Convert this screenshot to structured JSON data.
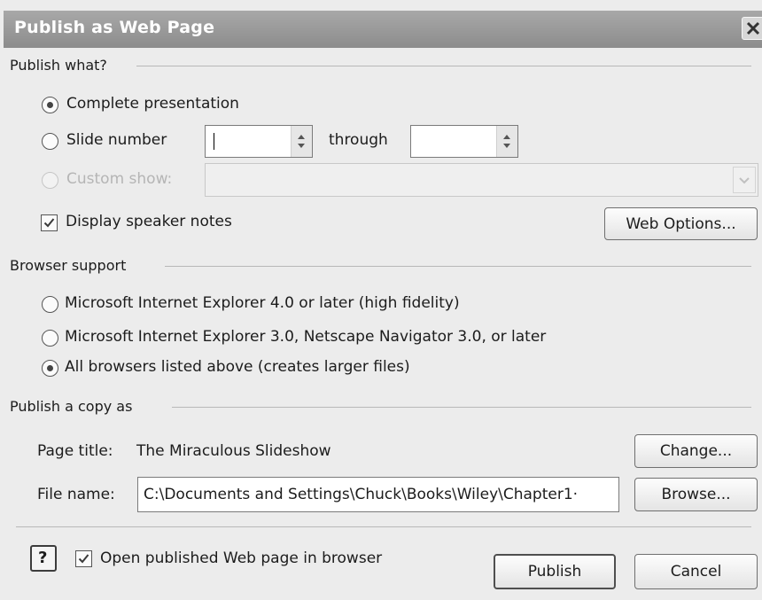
{
  "dialog": {
    "title": "Publish as Web Page",
    "close_icon": "close-icon"
  },
  "publish_what": {
    "legend": "Publish what?",
    "complete_label": "Complete presentation",
    "slide_number_label": "Slide number",
    "slide_from_value": "",
    "through_label": "through",
    "slide_to_value": "",
    "custom_show_label": "Custom show:",
    "custom_show_value": "",
    "speaker_notes_label": "Display speaker notes",
    "web_options_button": "Web Options..."
  },
  "browser_support": {
    "legend": "Browser support",
    "options": [
      "Microsoft Internet Explorer 4.0 or later (high fidelity)",
      "Microsoft Internet Explorer 3.0, Netscape Navigator 3.0, or later",
      "All browsers listed above (creates larger files)"
    ],
    "selected_index": 2
  },
  "publish_copy": {
    "legend": "Publish a copy as",
    "page_title_label": "Page title:",
    "page_title_value": "The Miraculous Slideshow",
    "change_button": "Change...",
    "file_name_label": "File name:",
    "file_name_value": "C:\\Documents and Settings\\Chuck\\Books\\Wiley\\Chapter1·",
    "browse_button": "Browse..."
  },
  "footer": {
    "help_label": "?",
    "open_in_browser_label": "Open published Web page in browser",
    "publish_button": "Publish",
    "cancel_button": "Cancel"
  }
}
